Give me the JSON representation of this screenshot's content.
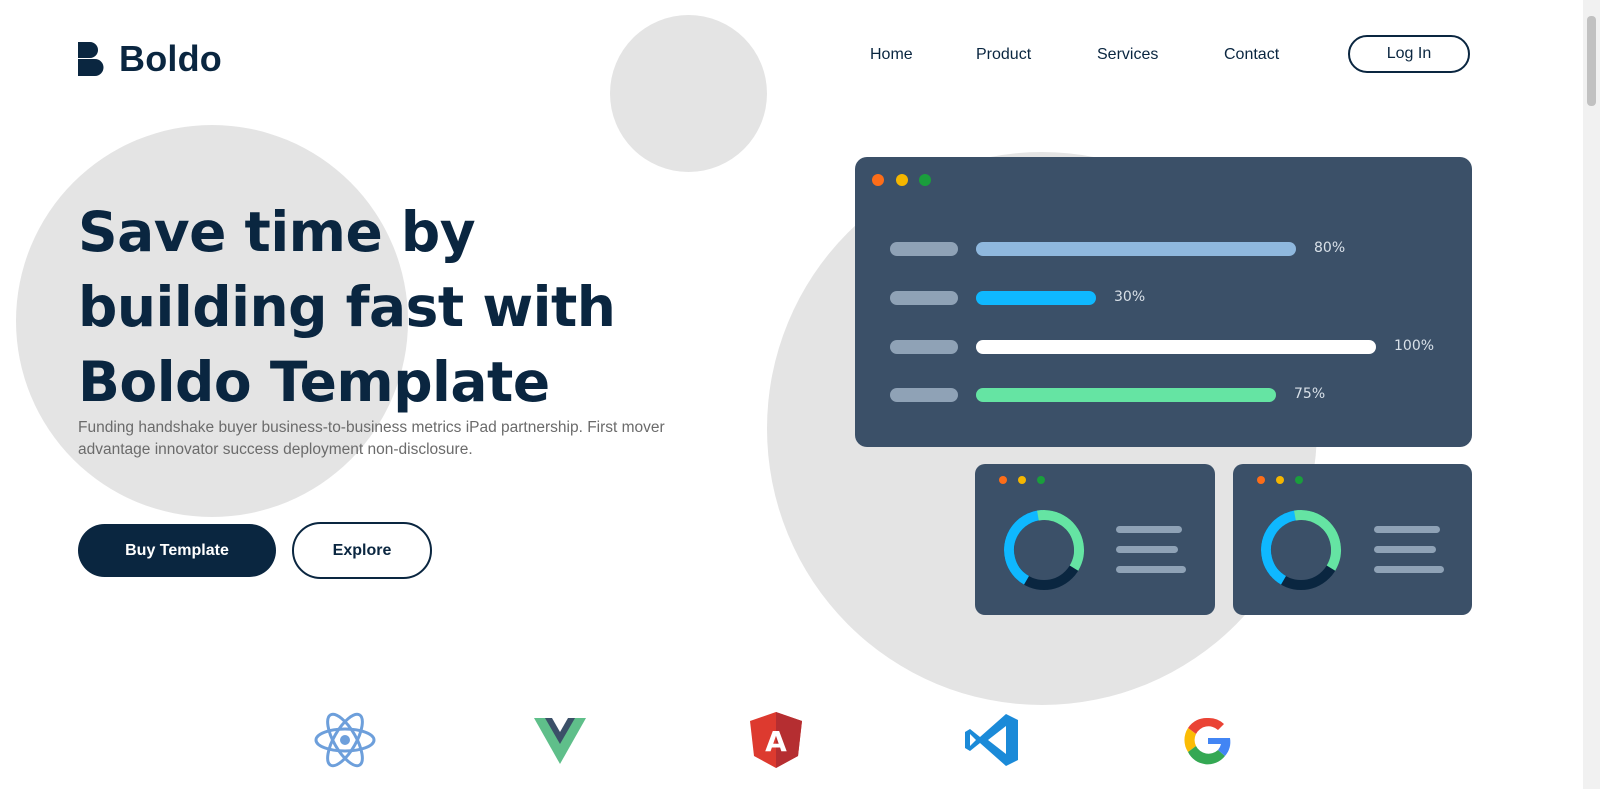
{
  "brand": {
    "name": "Boldo"
  },
  "nav": {
    "items": [
      "Home",
      "Product",
      "Services",
      "Contact"
    ],
    "login_label": "Log In"
  },
  "hero": {
    "title": "Save time by building fast with Boldo Template",
    "subtitle": "Funding handshake buyer business-to-business metrics iPad partnership. First mover advantage innovator success deployment non-disclosure.",
    "primary_button": "Buy Template",
    "secondary_button": "Explore"
  },
  "dashboard": {
    "bars": [
      {
        "percent_label": "80%",
        "value": 0.8,
        "color": "#8fb8de"
      },
      {
        "percent_label": "30%",
        "value": 0.3,
        "color": "#0fb8ff"
      },
      {
        "percent_label": "100%",
        "value": 1.0,
        "color": "#ffffff"
      },
      {
        "percent_label": "75%",
        "value": 0.75,
        "color": "#65e4a3"
      }
    ],
    "window_dot_colors": [
      "#fd6d18",
      "#f5b600",
      "#1a9e3c"
    ]
  },
  "tech_logos": [
    "react-icon",
    "vue-icon",
    "angular-icon",
    "vscode-icon",
    "google-icon"
  ],
  "colors": {
    "primary": "#0a2640",
    "panel": "#3b5068",
    "circle": "#e4e4e4"
  }
}
